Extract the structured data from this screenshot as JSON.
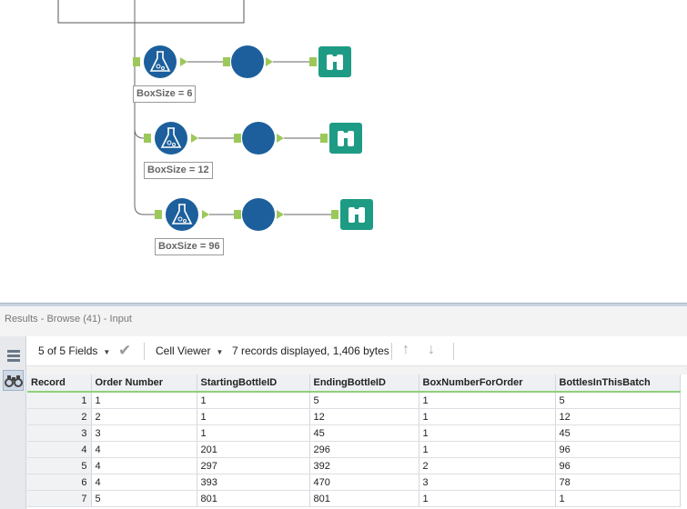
{
  "workflow": {
    "labels": [
      "BoxSize = 6",
      "BoxSize = 12",
      "BoxSize = 96"
    ],
    "colors": {
      "tool_blue": "#1c5f9c",
      "browse_teal": "#1e9b84",
      "anchor_green": "#9cc85a"
    }
  },
  "results": {
    "title": "Results - Browse (41) - Input",
    "sidebar_icons": [
      "list-view-icon",
      "binoculars-icon"
    ],
    "toolbar": {
      "fields_label": "5 of 5 Fields",
      "viewer_label": "Cell Viewer",
      "status": "7 records displayed, 1,406 bytes"
    },
    "columns": [
      "Record",
      "Order Number",
      "StartingBottleID",
      "EndingBottleID",
      "BoxNumberForOrder",
      "BottlesInThisBatch"
    ],
    "rows": [
      [
        "1",
        "1",
        "1",
        "5",
        "1",
        "5"
      ],
      [
        "2",
        "2",
        "1",
        "12",
        "1",
        "12"
      ],
      [
        "3",
        "3",
        "1",
        "45",
        "1",
        "45"
      ],
      [
        "4",
        "4",
        "201",
        "296",
        "1",
        "96"
      ],
      [
        "5",
        "4",
        "297",
        "392",
        "2",
        "96"
      ],
      [
        "6",
        "4",
        "393",
        "470",
        "3",
        "78"
      ],
      [
        "7",
        "5",
        "801",
        "801",
        "1",
        "1"
      ]
    ]
  }
}
